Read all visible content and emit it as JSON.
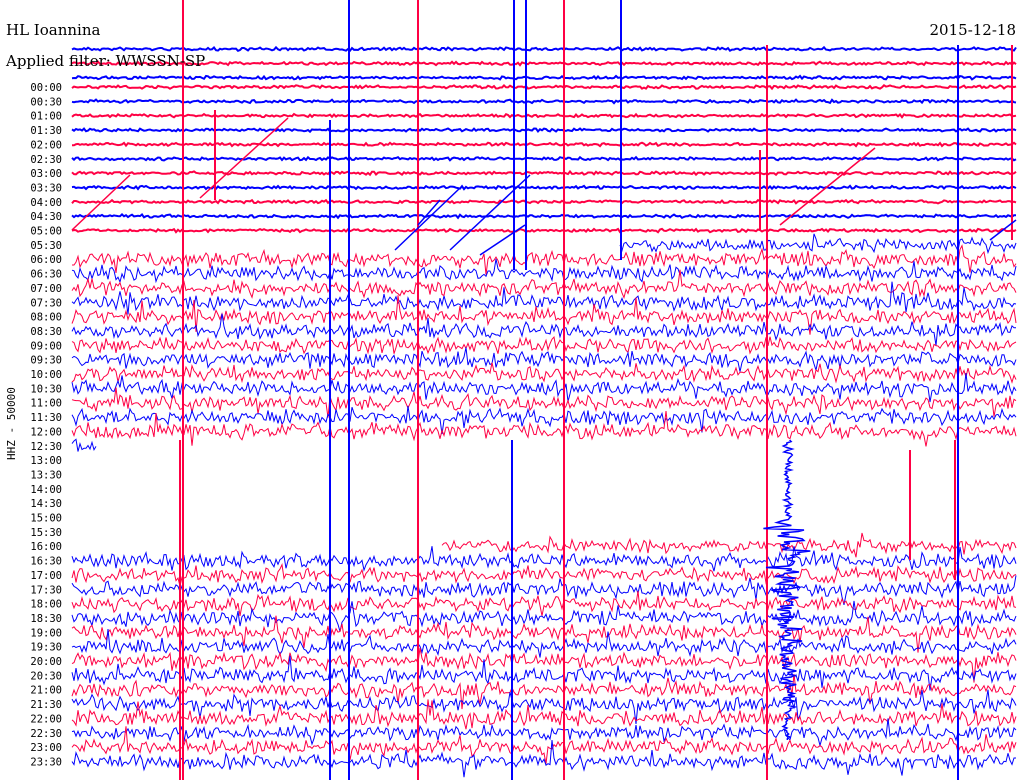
{
  "header": {
    "station": "HL Ioannina",
    "date": "2015-12-18",
    "filter": "Applied filter: WWSSN-SP"
  },
  "chart_data": {
    "type": "line",
    "title": "HL Ioannina",
    "subtitle": "Applied filter: WWSSN-SP",
    "ylabel": "HHZ - 50000",
    "trace_colors": [
      "#0000ff",
      "#ff0044"
    ],
    "y_tick_labels": [
      "00:00",
      "00:30",
      "01:00",
      "01:30",
      "02:00",
      "02:30",
      "03:00",
      "03:30",
      "04:00",
      "04:30",
      "05:00",
      "05:30",
      "06:00",
      "06:30",
      "07:00",
      "07:30",
      "08:00",
      "08:30",
      "09:00",
      "09:30",
      "10:00",
      "10:30",
      "11:00",
      "11:30",
      "12:00",
      "12:30",
      "13:00",
      "13:30",
      "14:00",
      "14:30",
      "15:00",
      "15:30",
      "16:00",
      "16:30",
      "17:00",
      "17:30",
      "18:00",
      "18:30",
      "19:00",
      "19:30",
      "20:00",
      "20:30",
      "21:00",
      "21:30",
      "22:00",
      "22:30",
      "23:00",
      "23:30"
    ],
    "noisy_rows": [
      "06:00",
      "06:30",
      "07:00",
      "07:30",
      "08:00",
      "08:30",
      "09:00",
      "09:30",
      "10:00",
      "10:30",
      "11:00",
      "11:30",
      "12:00",
      "16:30",
      "17:00",
      "17:30",
      "18:00",
      "18:30",
      "19:00",
      "19:30",
      "20:00",
      "20:30",
      "21:00",
      "21:30",
      "22:00",
      "22:30",
      "23:00",
      "23:30"
    ],
    "gap_rows": [
      "13:00",
      "13:30",
      "14:00",
      "14:30",
      "15:00",
      "15:30"
    ],
    "partial_rows": [
      "05:30",
      "12:30",
      "16:00"
    ],
    "event_time": "18:00"
  }
}
